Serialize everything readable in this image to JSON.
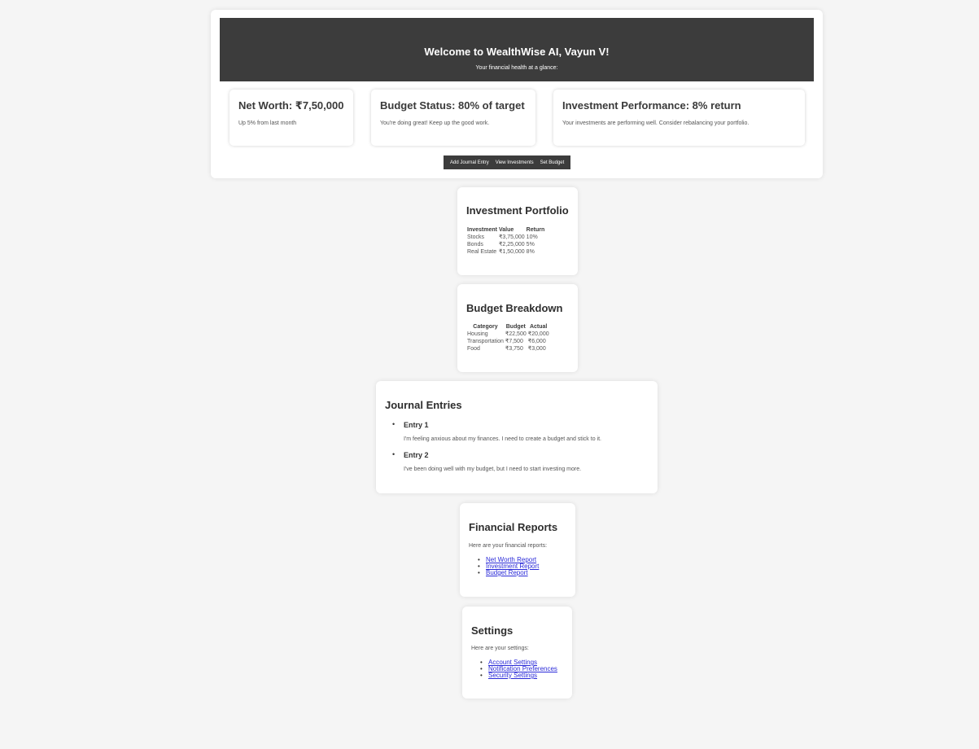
{
  "hero": {
    "title": "Welcome to WealthWise AI, Vayun V!",
    "subtitle": "Your financial health at a glance:"
  },
  "stats": {
    "net_worth": {
      "title": "Net Worth: ₹7,50,000",
      "desc": "Up 5% from last month"
    },
    "budget": {
      "title": "Budget Status: 80% of target",
      "desc": "You're doing great! Keep up the good work."
    },
    "investment": {
      "title": "Investment Performance: 8% return",
      "desc": "Your investments are performing well. Consider rebalancing your portfolio."
    }
  },
  "actions": {
    "add_journal": "Add Journal Entry",
    "view_investments": "View Investments",
    "set_budget": "Set Budget"
  },
  "portfolio": {
    "title": "Investment Portfolio",
    "headers": [
      "Investment",
      "Value",
      "Return"
    ],
    "rows": [
      [
        "Stocks",
        "₹3,75,000",
        "10%"
      ],
      [
        "Bonds",
        "₹2,25,000",
        "5%"
      ],
      [
        "Real Estate",
        "₹1,50,000",
        "8%"
      ]
    ]
  },
  "budget": {
    "title": "Budget Breakdown",
    "headers": [
      "Category",
      "Budget",
      "Actual"
    ],
    "rows": [
      [
        "Housing",
        "₹22,500",
        "₹20,000"
      ],
      [
        "Transportation",
        "₹7,500",
        "₹6,000"
      ],
      [
        "Food",
        "₹3,750",
        "₹3,000"
      ]
    ]
  },
  "journal": {
    "title": "Journal Entries",
    "entries": [
      {
        "title": "Entry 1",
        "text": "I'm feeling anxious about my finances. I need to create a budget and stick to it."
      },
      {
        "title": "Entry 2",
        "text": "I've been doing well with my budget, but I need to start investing more."
      }
    ]
  },
  "reports": {
    "title": "Financial Reports",
    "desc": "Here are your financial reports:",
    "links": [
      "Net Worth Report",
      "Investment Report",
      "Budget Report"
    ]
  },
  "settings": {
    "title": "Settings",
    "desc": "Here are your settings:",
    "links": [
      "Account Settings",
      "Notification Preferences",
      "Security Settings"
    ]
  }
}
